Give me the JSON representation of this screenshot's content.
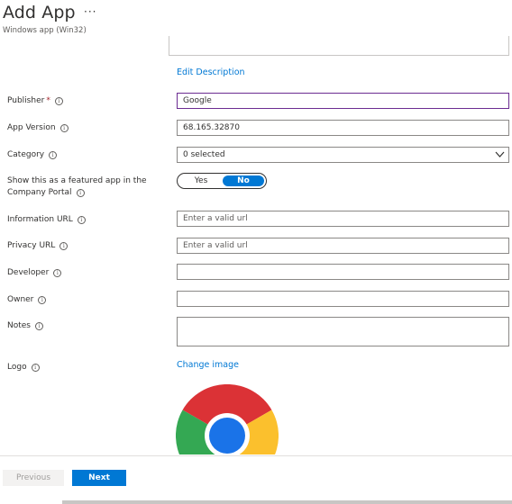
{
  "header": {
    "title": "Add App",
    "more_glyph": "···",
    "subtitle": "Windows app (Win32)"
  },
  "description": {
    "edit_link": "Edit Description"
  },
  "form": {
    "publisher": {
      "label": "Publisher",
      "required_mark": "*",
      "value": "Google"
    },
    "app_version": {
      "label": "App Version",
      "value": "68.165.32870"
    },
    "category": {
      "label": "Category",
      "value": "0 selected"
    },
    "featured": {
      "label_line1": "Show this as a featured app in the",
      "label_line2": "Company Portal",
      "yes": "Yes",
      "no": "No",
      "selected": "No"
    },
    "information_url": {
      "label": "Information URL",
      "placeholder": "Enter a valid url"
    },
    "privacy_url": {
      "label": "Privacy URL",
      "placeholder": "Enter a valid url"
    },
    "developer": {
      "label": "Developer",
      "value": ""
    },
    "owner": {
      "label": "Owner",
      "value": ""
    },
    "notes": {
      "label": "Notes",
      "value": ""
    },
    "logo": {
      "label": "Logo",
      "change_link": "Change image"
    }
  },
  "footer": {
    "previous": "Previous",
    "next": "Next"
  },
  "colors": {
    "accent": "#0078d4",
    "focus_border": "#6b2c91",
    "required": "#a4262c"
  },
  "icons": {
    "info": "info-icon",
    "dropdown": "chevron-down-icon",
    "logo": "chrome-logo-icon"
  }
}
